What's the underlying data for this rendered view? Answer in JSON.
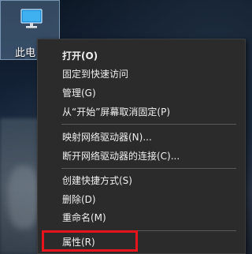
{
  "desktop": {
    "icon": {
      "label": "此电",
      "icon_name": "computer-monitor-icon"
    }
  },
  "context_menu": {
    "items": [
      {
        "label": "打开(O)",
        "bold": true
      },
      {
        "label": "固定到快速访问"
      },
      {
        "label": "管理(G)"
      },
      {
        "label": "从“开始”屏幕取消固定(P)"
      },
      {
        "label": "映射网络驱动器(N)..."
      },
      {
        "label": "断开网络驱动器的连接(C)..."
      },
      {
        "label": "创建快捷方式(S)"
      },
      {
        "label": "删除(D)"
      },
      {
        "label": "重命名(M)"
      },
      {
        "label": "属性(R)"
      }
    ]
  },
  "colors": {
    "menu_background": "#2b2b2b",
    "menu_text": "#f0f0f0",
    "highlight_border": "#e8141b"
  }
}
